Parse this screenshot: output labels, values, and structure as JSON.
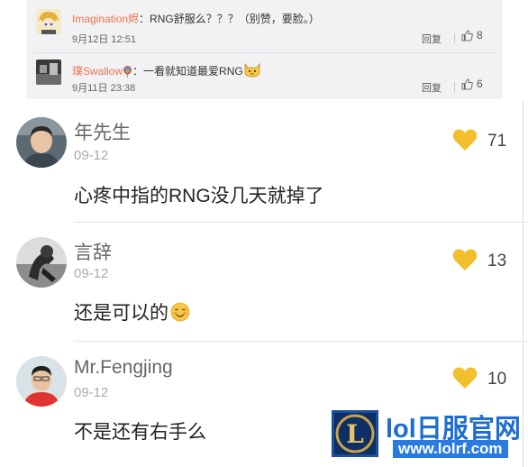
{
  "weibo_comments": [
    {
      "name": "Imagination烬",
      "text": "：RNG舒服么？？？（别赞，要脸。）",
      "time": "9月12日 12:51",
      "reply_label": "回复",
      "likes": "8"
    },
    {
      "name": "璞Swallow",
      "text": "：一看就知道最爱RNG",
      "time": "9月11日 23:38",
      "reply_label": "回复",
      "likes": "6"
    }
  ],
  "app_comments": [
    {
      "name": "年先生",
      "date": "09-12",
      "text": "心疼中指的RNG没几天就掉了",
      "likes": "71"
    },
    {
      "name": "言辞",
      "date": "09-12",
      "text": "还是可以的",
      "likes": "13"
    },
    {
      "name": "Mr.Fengjing",
      "date": "09-12",
      "text": "不是还有右手么",
      "likes": "10"
    }
  ],
  "watermark": {
    "title": "lol日服官网",
    "url": "www.lolrf.com",
    "logo_letter": "L"
  },
  "colors": {
    "heart": "#f2c02c",
    "weibo_name": "#eb7350",
    "watermark_blue": "#1d6ed3"
  }
}
